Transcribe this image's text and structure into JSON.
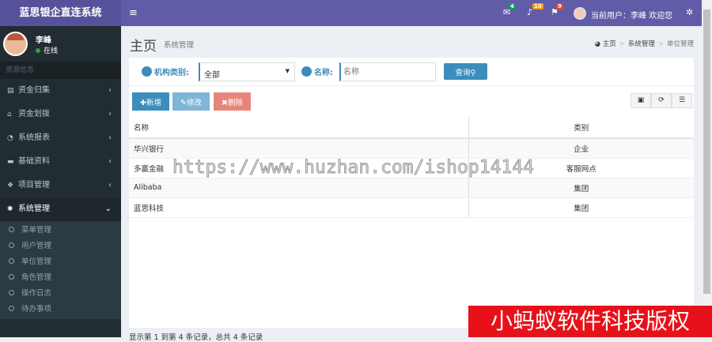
{
  "header": {
    "logo": "蓝思银企直连系统",
    "menu_toggle": "≡",
    "mail_count": "4",
    "bell_count": "10",
    "flag_count": "9",
    "user_text": "当前用户：李峰 欢迎您",
    "colors": {
      "primary": "#605ca8",
      "mail": "#00a65a",
      "bell": "#f39c12",
      "flag": "#dd4b39"
    }
  },
  "sidebar": {
    "user_name": "李峰",
    "user_status": "在线",
    "section_header": "资源信息",
    "items": [
      {
        "label": "资金归集",
        "icon": "▤"
      },
      {
        "label": "资金划拨",
        "icon": "⌂"
      },
      {
        "label": "系统报表",
        "icon": "◔"
      },
      {
        "label": "基础资料",
        "icon": "▬"
      },
      {
        "label": "项目管理",
        "icon": "❖"
      },
      {
        "label": "系统管理",
        "icon": "✺"
      }
    ],
    "sub_items": [
      "菜单管理",
      "用户管理",
      "单位管理",
      "角色管理",
      "操作日志",
      "待办事项"
    ]
  },
  "page": {
    "title": "主页",
    "subtitle": "系统管理",
    "breadcrumb": [
      "主页",
      "系统管理",
      "单位管理"
    ]
  },
  "filter": {
    "type_label": "机构类别:",
    "type_value": "全部",
    "name_label": "名称:",
    "name_placeholder": "名称",
    "query_button": "查询"
  },
  "toolbar": {
    "add": "新增",
    "edit": "修改",
    "delete": "删除"
  },
  "table": {
    "columns": [
      "名称",
      "类别"
    ],
    "rows": [
      [
        "华兴银行",
        "企业"
      ],
      [
        "多赢金融",
        "客服网点"
      ],
      [
        "Alibaba",
        "集团"
      ],
      [
        "蓝思科技",
        "集团"
      ]
    ]
  },
  "footer": "显示第 1 到第 4 条记录，总共 4 条记录",
  "watermark": "https://www.huzhan.com/ishop14144",
  "copyright": "小蚂蚁软件科技版权"
}
